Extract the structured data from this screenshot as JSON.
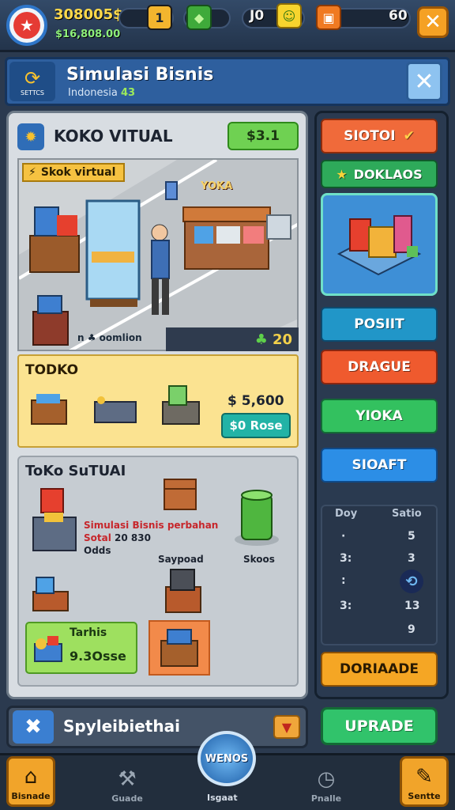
{
  "top_bar": {
    "money": "308005$",
    "money_sub": "$16,808.00",
    "resource_1": {
      "icon": "plus-icon",
      "value": "1"
    },
    "resource_2": {
      "icon": "gem-icon",
      "value": ""
    },
    "resource_3": {
      "icon": "smiley-icon",
      "value": "J0"
    },
    "resource_4": {
      "icon": "gift-icon",
      "value": "60"
    },
    "close_icon": "close-icon"
  },
  "header": {
    "logo_caption": "SETTCS",
    "title": "Simulasi Bisnis",
    "subtitle": "Indonesia",
    "subtitle_highlight": "43"
  },
  "main": {
    "title": "KOKO VITUAL",
    "badge": "$3.1",
    "scene_tag": "Skok virtual",
    "scene_sign": "YOKA",
    "scene_note": "n  ♣ oomlion",
    "scene_counter": "20",
    "shop_title": "TODKO",
    "price": "$ 5,600",
    "buy_label": "$0 Rose",
    "sub_title": "ToKo SuTUAI",
    "sim_line1": "Simulasi Bisnis perbahan",
    "sim_line2": "Sotal",
    "sim_value": "20 830",
    "sim_line3": "Odds",
    "item_saypoad": "Saypoad",
    "item_skoos": "Skoos",
    "selected_label": "Tarhis",
    "selected_value": "9.3Osse"
  },
  "sidebar": {
    "buttons": [
      {
        "label": "SIOTOI",
        "color": "#f06a3a"
      },
      {
        "label": "DOKLAOS",
        "color": "#2eaa5a"
      },
      {
        "label": "POSIIT",
        "color": "#2196c8"
      },
      {
        "label": "DRAGUE",
        "color": "#ef5a2e"
      },
      {
        "label": "YIOKA",
        "color": "#33c15f"
      },
      {
        "label": "SIOAFT",
        "color": "#2c8ee6"
      }
    ],
    "stats": {
      "col1_header": "Doy",
      "col2_header": "Satio",
      "rows": [
        [
          "·",
          "5"
        ],
        [
          "3:",
          "3"
        ],
        [
          ":",
          ""
        ],
        [
          "3:",
          "13"
        ],
        [
          "",
          "9"
        ]
      ]
    },
    "bottom_button": "DORIAADE"
  },
  "bottom": {
    "field_text": "Spyleibiethai",
    "upgrade_label": "UPRADE"
  },
  "nav": {
    "home": "Bisnade",
    "guide": "Guade",
    "center": "WENOS",
    "center_label": "Isgaat",
    "profile": "Pnalle",
    "settings": "Sentte"
  }
}
